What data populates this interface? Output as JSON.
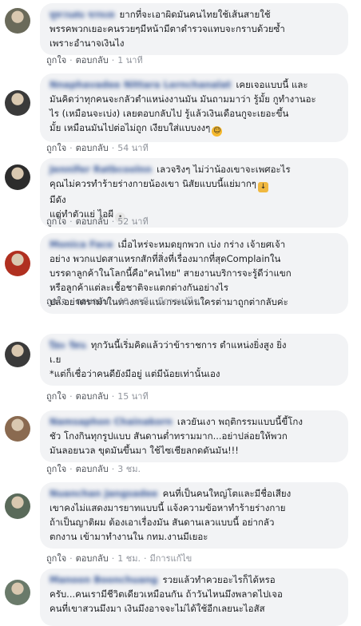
{
  "actions": {
    "like": "ถูกใจ",
    "reply": "ตอบกลับ",
    "edited": "มีการแก้ไข"
  },
  "comments": [
    {
      "author": "ทูทวนสม ขรจงล",
      "lines": [
        "ยากที่จะเอาผิดมันคนไทยใช้เส้นสายใช้",
        "พรรคพวกเยอะคนรวยๆมีหน้ามีตาตำรวจแทบจะกราบด้วยซ้ำ",
        "เพราะอำนาจเงินไง"
      ],
      "time": "1 นาที",
      "edited": false,
      "avatar_color": "#6a6a5a"
    },
    {
      "author": "Nnaphavadee Nittara Lernchanalat",
      "lines": [
        "เคยเจอแบบนี้ และ",
        "มันคิดว่าทุกคนจะกลัวตำแหน่งงานมัน มันถามมาว่า รู้มั้ย กูทำงานอะ",
        "ไร (เหมือนจะเบ่ง) เลยตอบกลับไป รู้แล้วเงินเดือนกูจะเยอะขึ้น",
        "มั้ย เหมือนมันไปต่อไม่ถูก เงียบใส่แบบงงๆ"
      ],
      "emoji_after_last": "laugh",
      "time": "54 นาที",
      "edited": false,
      "avatar_color": "#3a3a3a"
    },
    {
      "author": "Jennifer Ratbcoolnn",
      "lines": [
        "เลวจริงๆ ไม่ว่าน้องเขาจะเพศอะไร",
        "คุณไม่ควรทำร้ายร่างกายน้องเขา นิสัยแบบนี้แย่มากๆ",
        "มีดัง",
        "แต่ทำตัวแย่ ไอผี"
      ],
      "emoji_after_line2": "thumbs-down",
      "emoji_after_last": "ghost",
      "time": "52 นาที",
      "edited": false,
      "avatar_color": "#2c2c2c"
    },
    {
      "author": "Monica Face",
      "lines": [
        "เมื่อไหร่จะหมดยุกพวก เบ่ง กร่าง เจ้ายศเจ้า",
        "อย่าง พวกแปดสาแหรกสักที่สิ่งที่เรื่องมากที่สุดComplainใน",
        "บรรดาลูกค้าในโลกนี้คือ\"คนไทย\" สายงานบริการจะรู้ดีว่าแขก",
        "หรือลูกค้าแต่ละเชื้อชาติจะแตกต่างกันอย่างไร",
        "ปล.อย่าดราม่าในทางกระแนะกระแหนใครต่ามาถูกต่ากลับค่ะ"
      ],
      "time": "40 นาที",
      "edited": true,
      "avatar_color": "#b03020"
    },
    {
      "author": "ปิยะ รัตน",
      "lines": [
        "ทุกวันนี้เริ่มคิดแล้วว่าข้าราชการ ตำแหน่งยิ่งสูง ยิ่ง",
        "เ.ย",
        "*แต่ก็เชื่อว่าคนดียังมีอยู่ แต่มีน้อยเท่านั้นเอง"
      ],
      "time": "15 นาที",
      "edited": false,
      "avatar_color": "#3a3a3a"
    },
    {
      "author": "Namsaphon Chainakorn",
      "lines": [
        "เลวยันเงา พฤติกรรมแบบนี้ขี้โกง",
        "ชัว โกงกินทุกรูปแบบ สันดานต่ำทรามมาก...อย่าปล่อยให้พวก",
        "มันลอยนวล ขุดมันขึ้นมา ใช้ไซเชียลกดดันมัน!!!"
      ],
      "time": "3 ชม.",
      "edited": false,
      "avatar_color": "#8a6a50"
    },
    {
      "author": "Nuanchan Jangsadee",
      "lines": [
        "คนที่เป็นคนใหญ่โตและมีชื่อเสียง",
        "เขาคงไม่แสดงมารยาทแบบนี้ แจ้งความข้อหาทำร้ายร่างกาย",
        "ถ้าเป็นญาติผม ต้องเอาเรื่องมัน สันดานเลวแบบนี้ อย่ากลัว",
        "ตกงาน เข้ามาทำงานใน กทม.งานมีเยอะ"
      ],
      "time": "1 ชม.",
      "edited": true,
      "avatar_color": "#5a6a5a"
    },
    {
      "author": "Manoon Boonchuang",
      "lines": [
        "รวยแล้วทำควยอะไรก็ได้หรอ",
        "ครับ...คนเรามีชีวิตเดียวเหมือนกัน ถ้าวันไหนมึงพลาดไปเจอ",
        "คนที่เขาสวนมึงมา เงินมึงอาจจะไม่ได้ใช้อีกเลยนะไอสัส"
      ],
      "time": "",
      "edited": false,
      "avatar_color": "#6a7a6a"
    }
  ]
}
